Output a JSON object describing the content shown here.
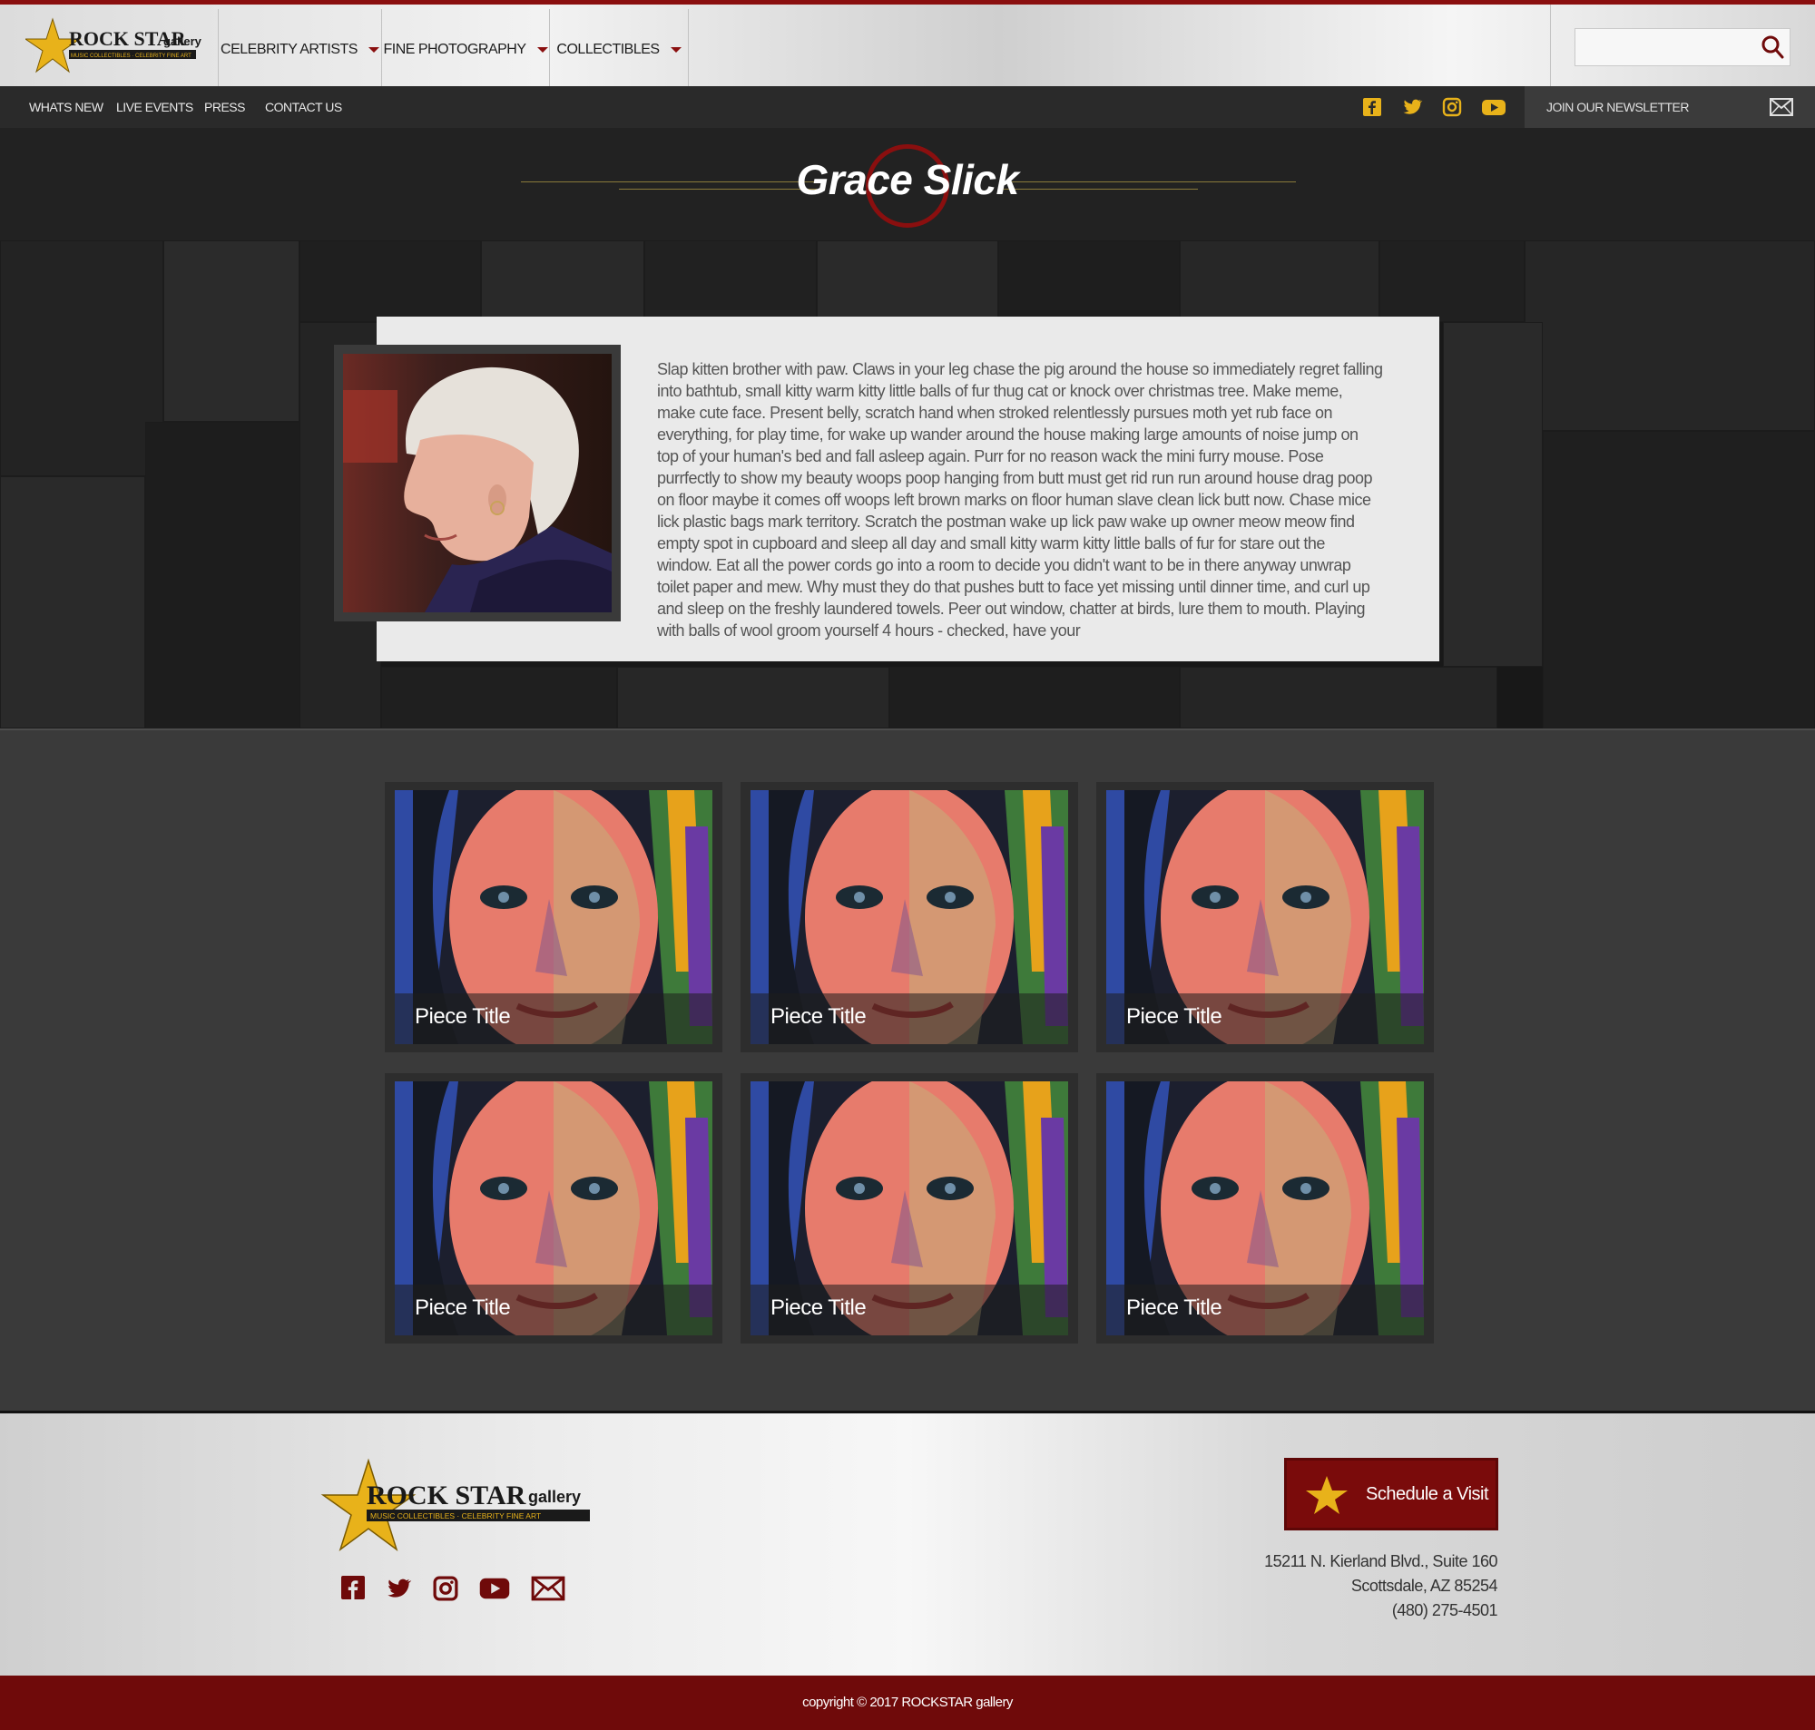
{
  "brand": {
    "logo_main": "ROCK STAR",
    "logo_sub": "gallery",
    "logo_tagline": "MUSIC COLLECTIBLES · CELEBRITY FINE ART",
    "accent_color": "#8a0f0f",
    "gold_color": "#e8b21a"
  },
  "header": {
    "nav": [
      {
        "label": "CELEBRITY ARTISTS",
        "has_dropdown": true
      },
      {
        "label": "FINE PHOTOGRAPHY",
        "has_dropdown": true
      },
      {
        "label": "COLLECTIBLES",
        "has_dropdown": true
      }
    ],
    "search": {
      "value": "",
      "placeholder": "",
      "icon": "search-icon"
    }
  },
  "subnav": {
    "links": [
      {
        "label": "WHATS NEW"
      },
      {
        "label": "LIVE EVENTS"
      },
      {
        "label": "PRESS"
      },
      {
        "label": "CONTACT US"
      }
    ],
    "social": [
      "facebook-icon",
      "twitter-icon",
      "instagram-icon",
      "youtube-icon"
    ],
    "newsletter_label": "JOIN OUR NEWSLETTER",
    "newsletter_icon": "envelope-icon"
  },
  "artist": {
    "name": "Grace Slick",
    "bio": "Slap kitten brother with paw. Claws in your leg chase the pig around the house so immediately regret falling into bathtub, small kitty warm kitty little balls of fur thug cat or knock over christmas tree. Make meme, make cute face. Present belly, scratch hand when stroked relentlessly pursues moth yet rub face on everything, for play time, for wake up wander around the house making large amounts of noise jump on top of your human's bed and fall asleep again. Purr for no reason wack the mini furry mouse. Pose purrfectly to show my beauty woops poop hanging from butt must get rid run run around house drag poop on floor maybe it comes off woops left brown marks on floor human slave clean lick butt now. Chase mice lick plastic bags mark territory. Scratch the postman wake up lick paw wake up owner meow meow find empty spot in cupboard and sleep all day and small kitty warm kitty little balls of fur for stare out the window. Eat all the power cords go into a room to decide you didn't want to be in there anyway unwrap toilet paper and mew. Why must they do that pushes butt to face yet missing until dinner time, and curl up and sleep on the freshly laundered towels. Peer out window, chatter at birds, lure them to mouth. Playing with balls of wool groom yourself 4 hours - checked, have your"
  },
  "gallery": {
    "pieces": [
      {
        "title": "Piece Title"
      },
      {
        "title": "Piece Title"
      },
      {
        "title": "Piece Title"
      },
      {
        "title": "Piece Title"
      },
      {
        "title": "Piece Title"
      },
      {
        "title": "Piece Title"
      }
    ]
  },
  "footer": {
    "social": [
      "facebook-icon",
      "twitter-icon",
      "instagram-icon",
      "youtube-icon",
      "envelope-icon"
    ],
    "schedule_label": "Schedule a Visit",
    "address_line1": "15211 N. Kierland Blvd., Suite 160",
    "address_line2": "Scottsdale, AZ 85254",
    "phone": "(480) 275-4501",
    "copyright": "copyright © 2017 ROCKSTAR gallery"
  }
}
